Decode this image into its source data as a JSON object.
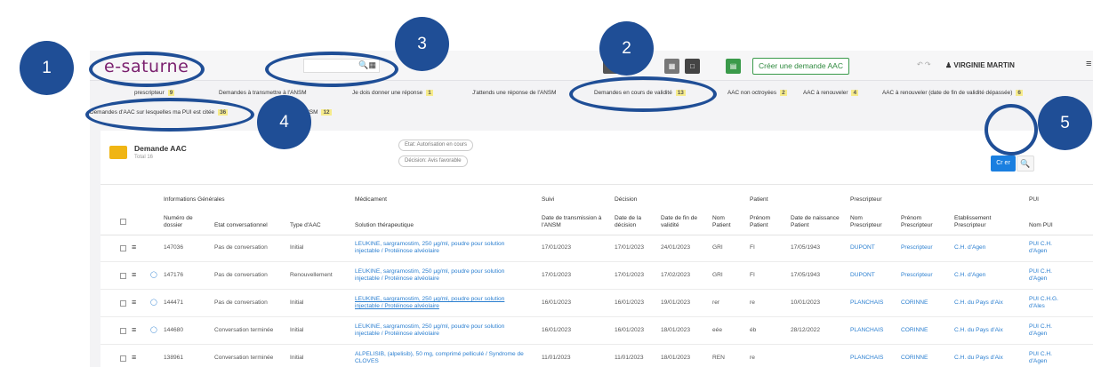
{
  "header": {
    "logo": "e-saturne",
    "search_icon": "search-icon",
    "create_button": "Créer une demande AAC",
    "user_name": "VIRGINIE MARTIN",
    "undo_redo": "↶ ↷"
  },
  "filters": [
    {
      "label": "prescripteur",
      "count": "9"
    },
    {
      "label": "Demandes à transmettre à l'ANSM",
      "count": ""
    },
    {
      "label": "Je dois donner une réponse",
      "count": "1"
    },
    {
      "label": "J'attends une réponse de l'ANSM",
      "count": ""
    },
    {
      "label": "Demandes en cours de validité",
      "count": "13"
    },
    {
      "label": "AAC non octroyées",
      "count": "2"
    },
    {
      "label": "AAC à renouveler",
      "count": "4"
    },
    {
      "label": "AAC à renouveler (date de fin de validité dépassée)",
      "count": "6"
    },
    {
      "label": "Demandes d'AAC sur lesquelles ma PUI est citée",
      "count": "36"
    },
    {
      "label": "ANSM",
      "count": "12"
    }
  ],
  "card": {
    "title": "Demande AAC",
    "subtitle": "Total 16",
    "chips": [
      "Etat: Autorisation en cours",
      "Décision: Avis favorable"
    ],
    "blue_button": "Cr  er"
  },
  "table": {
    "groups": [
      "Informations Générales",
      "Médicament",
      "Suivi",
      "Décision",
      "Patient",
      "Prescripteur",
      "PUI"
    ],
    "columns": [
      "Numéro de dossier",
      "Etat conversationnel",
      "Type d'AAC",
      "Solution thérapeutique",
      "Date de transmission à l'ANSM",
      "Date de la décision",
      "Date de fin de validité",
      "Nom Patient",
      "Prénom Patient",
      "Date de naissance Patient",
      "Nom Prescripteur",
      "Prénom Prescripteur",
      "Etablissement Prescripteur",
      "Nom PUI"
    ],
    "rows": [
      {
        "dossier": "147036",
        "etat": "Pas de conversation",
        "type": "Initial",
        "solution": "LEUKINE, sargramostim, 250 µg/ml, poudre pour solution injectable / Protéinose alvéolaire",
        "transmission": "17/01/2023",
        "decision": "17/01/2023",
        "fin": "24/01/2023",
        "nom": "GRI",
        "prenom": "FI",
        "naissance": "17/05/1943",
        "nom_presc": "DUPONT",
        "prenom_presc": "Prescripteur",
        "etab": "C.H. d'Agen",
        "pui": "PUI C.H. d'Agen"
      },
      {
        "dossier": "147176",
        "etat": "Pas de conversation",
        "type": "Renouvellement",
        "solution": "LEUKINE, sargramostim, 250 µg/ml, poudre pour solution injectable / Protéinose alvéolaire",
        "transmission": "17/01/2023",
        "decision": "17/01/2023",
        "fin": "17/02/2023",
        "nom": "GRI",
        "prenom": "FI",
        "naissance": "17/05/1943",
        "nom_presc": "DUPONT",
        "prenom_presc": "Prescripteur",
        "etab": "C.H. d'Agen",
        "pui": "PUI C.H. d'Agen"
      },
      {
        "dossier": "144471",
        "etat": "Pas de conversation",
        "type": "Initial",
        "solution": "LEUKINE, sargramostim, 250 µg/ml, poudre pour solution injectable / Protéinose alvéolaire",
        "transmission": "16/01/2023",
        "decision": "16/01/2023",
        "fin": "19/01/2023",
        "nom": "rer",
        "prenom": "re",
        "naissance": "10/01/2023",
        "nom_presc": "PLANCHAIS",
        "prenom_presc": "CORINNE",
        "etab": "C.H. du Pays d'Aix",
        "pui": "PUI C.H.G. d'Ales"
      },
      {
        "dossier": "144680",
        "etat": "Conversation terminée",
        "type": "Initial",
        "solution": "LEUKINE, sargramostim, 250 µg/ml, poudre pour solution injectable / Protéinose alvéolaire",
        "transmission": "16/01/2023",
        "decision": "16/01/2023",
        "fin": "18/01/2023",
        "nom": "eée",
        "prenom": "éb",
        "naissance": "28/12/2022",
        "nom_presc": "PLANCHAIS",
        "prenom_presc": "CORINNE",
        "etab": "C.H. du Pays d'Aix",
        "pui": "PUI C.H. d'Agen"
      },
      {
        "dossier": "138961",
        "etat": "Conversation terminée",
        "type": "Initial",
        "solution": "ALPELISIB, (alpelisib), 50 mg, comprimé pelliculé / Syndrome de CLOVES",
        "transmission": "11/01/2023",
        "decision": "11/01/2023",
        "fin": "18/01/2023",
        "nom": "REN",
        "prenom": "re",
        "naissance": "",
        "nom_presc": "PLANCHAIS",
        "prenom_presc": "CORINNE",
        "etab": "C.H. du Pays d'Aix",
        "pui": "PUI C.H. d'Agen"
      }
    ]
  },
  "annotations": [
    "1",
    "2",
    "3",
    "4",
    "5"
  ],
  "colors": {
    "annotation": "#1f4e96",
    "accent_blue": "#1a7fe0",
    "logo": "#7a1f6e",
    "count_badge": "#f6eb8b"
  }
}
